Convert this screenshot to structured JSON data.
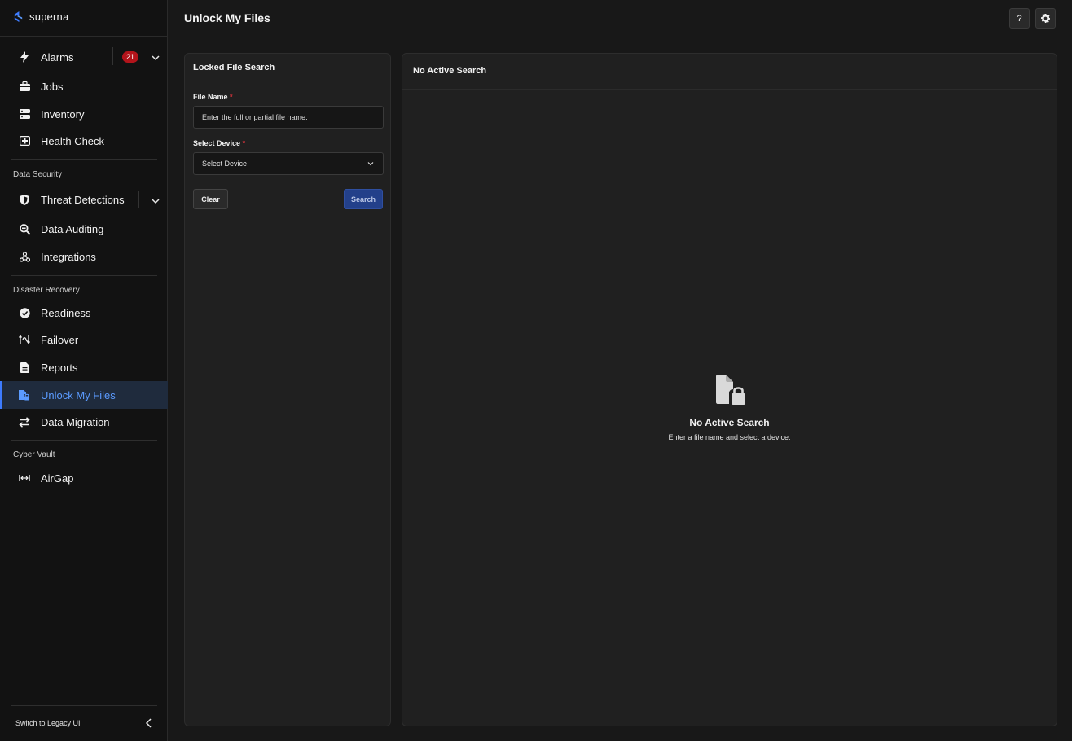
{
  "brand": {
    "name": "superna",
    "accent": "#3d7bff"
  },
  "sidebar": {
    "items": [
      {
        "label": "Alarms",
        "icon": "bolt-icon",
        "badge": "21"
      },
      {
        "label": "Jobs",
        "icon": "briefcase-icon"
      },
      {
        "label": "Inventory",
        "icon": "server-icon"
      },
      {
        "label": "Health Check",
        "icon": "health-icon"
      }
    ],
    "data_security": {
      "label": "Data Security",
      "items": [
        {
          "label": "Threat Detections",
          "icon": "shield-icon"
        },
        {
          "label": "Data Auditing",
          "icon": "search-zoom-icon"
        },
        {
          "label": "Integrations",
          "icon": "webhook-icon"
        }
      ]
    },
    "disaster_recovery": {
      "label": "Disaster Recovery",
      "items": [
        {
          "label": "Readiness",
          "icon": "check-circle-icon"
        },
        {
          "label": "Failover",
          "icon": "failover-icon"
        },
        {
          "label": "Reports",
          "icon": "document-icon"
        },
        {
          "label": "Unlock My Files",
          "icon": "file-lock-icon",
          "active": true
        },
        {
          "label": "Data Migration",
          "icon": "swap-arrows-icon"
        }
      ]
    },
    "cyber_vault": {
      "label": "Cyber Vault",
      "items": [
        {
          "label": "AirGap",
          "icon": "airgap-icon"
        }
      ]
    },
    "switch_legacy": "Switch to Legacy UI"
  },
  "header": {
    "title": "Unlock My Files",
    "help_label": "?"
  },
  "search_panel": {
    "title": "Locked File Search",
    "file_name_label": "File Name",
    "file_name_placeholder": "Enter the full or partial file name.",
    "device_label": "Select Device",
    "device_value": "Select Device",
    "required_mark": "*",
    "clear_label": "Clear",
    "search_label": "Search"
  },
  "results_panel": {
    "title": "No Active Search",
    "empty_title": "No Active Search",
    "empty_subtitle": "Enter a file name and select a device."
  }
}
